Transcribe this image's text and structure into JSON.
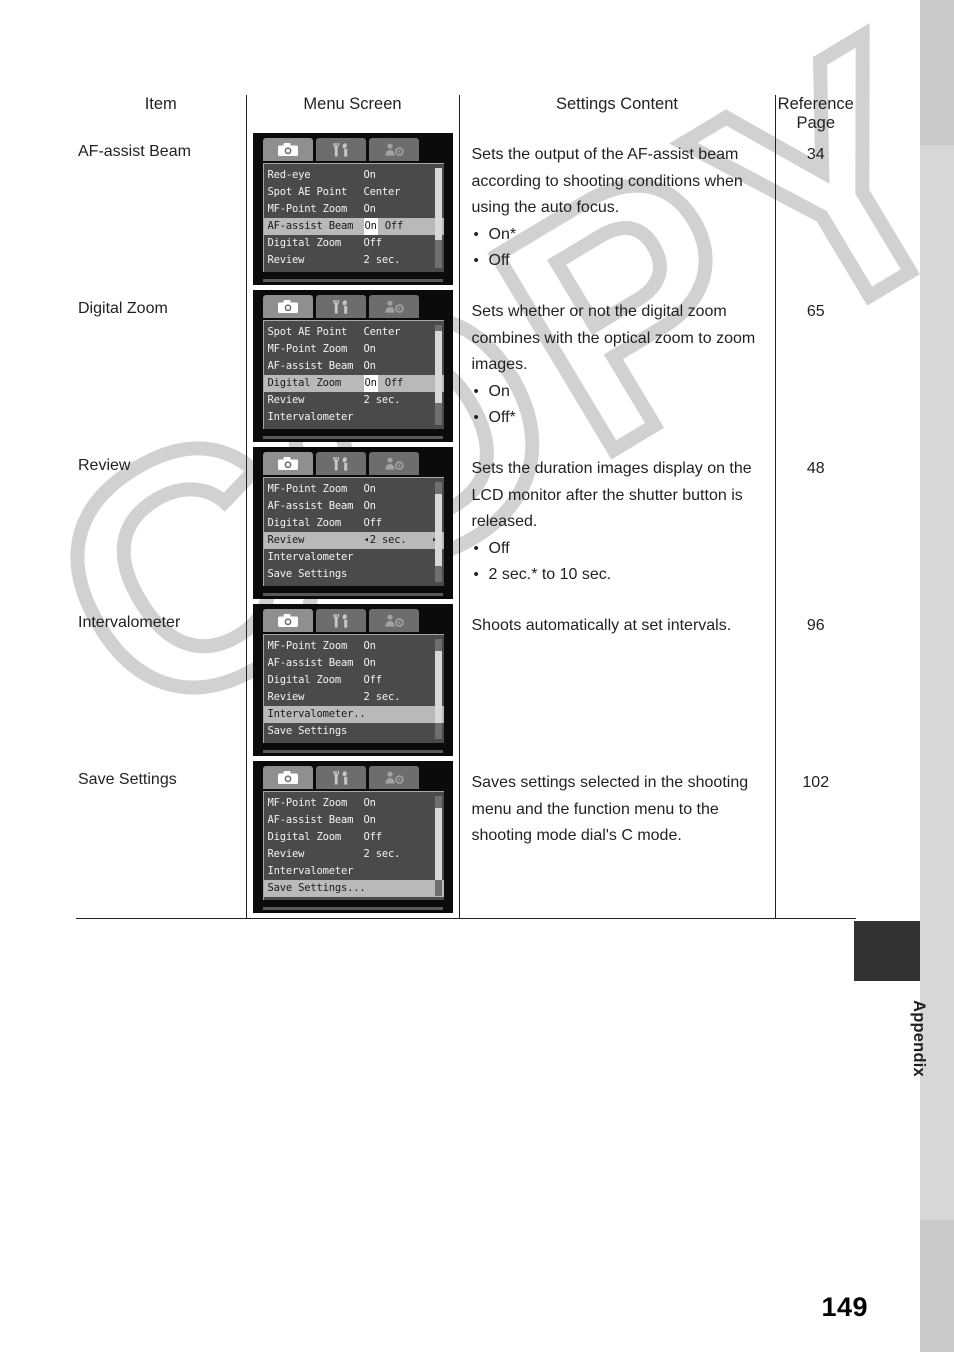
{
  "page": {
    "number": "149",
    "section_tab": "Appendix",
    "watermark": "COPY"
  },
  "table": {
    "headers": {
      "item": "Item",
      "menu_screen": "Menu Screen",
      "settings_content": "Settings Content",
      "reference_page_line1": "Reference",
      "reference_page_line2": "Page"
    },
    "rows": [
      {
        "item": "AF-assist Beam",
        "description_lines": [
          "Sets the output of the AF-assist beam",
          "according to shooting conditions when",
          "using the auto focus."
        ],
        "options": [
          "On*",
          "Off"
        ],
        "reference": "34",
        "menu": {
          "tabs": [
            "camera-icon",
            "tools-icon",
            "setup-icon"
          ],
          "active_tab": 0,
          "entries": [
            {
              "label": "Red-eye",
              "value": "On",
              "value2": "",
              "selected": false,
              "boxed": false,
              "arrows": false
            },
            {
              "label": "Spot AE Point",
              "value": "Center",
              "value2": "",
              "selected": false,
              "boxed": false,
              "arrows": false
            },
            {
              "label": "MF-Point Zoom",
              "value": "On",
              "value2": "",
              "selected": false,
              "boxed": false,
              "arrows": false
            },
            {
              "label": "AF-assist Beam",
              "value": "On",
              "value2": "Off",
              "selected": true,
              "boxed": true,
              "arrows": false
            },
            {
              "label": "Digital Zoom",
              "value": "Off",
              "value2": "",
              "selected": false,
              "boxed": false,
              "arrows": false
            },
            {
              "label": "Review",
              "value": "2 sec.",
              "value2": "",
              "selected": false,
              "boxed": false,
              "arrows": false
            }
          ],
          "scroll_top_pct": 0,
          "scroll_height_pct": 72
        }
      },
      {
        "item": "Digital Zoom",
        "description_lines": [
          "Sets whether or not the digital zoom",
          "combines with the optical zoom to zoom",
          "images."
        ],
        "options": [
          "On",
          "Off*"
        ],
        "reference": "65",
        "menu": {
          "tabs": [
            "camera-icon",
            "tools-icon",
            "setup-icon"
          ],
          "active_tab": 0,
          "entries": [
            {
              "label": "Spot AE Point",
              "value": "Center",
              "value2": "",
              "selected": false,
              "boxed": false,
              "arrows": false
            },
            {
              "label": "MF-Point Zoom",
              "value": "On",
              "value2": "",
              "selected": false,
              "boxed": false,
              "arrows": false
            },
            {
              "label": "AF-assist Beam",
              "value": "On",
              "value2": "",
              "selected": false,
              "boxed": false,
              "arrows": false
            },
            {
              "label": "Digital Zoom",
              "value": "On",
              "value2": "Off",
              "selected": true,
              "boxed": true,
              "arrows": false
            },
            {
              "label": "Review",
              "value": "2 sec.",
              "value2": "",
              "selected": false,
              "boxed": false,
              "arrows": false
            },
            {
              "label": "Intervalometer",
              "value": "",
              "value2": "",
              "selected": false,
              "boxed": false,
              "arrows": false
            }
          ],
          "scroll_top_pct": 6,
          "scroll_height_pct": 72
        }
      },
      {
        "item": "Review",
        "description_lines": [
          "Sets the duration images display on the",
          "LCD monitor after the shutter button is",
          "released."
        ],
        "options": [
          "Off",
          "2 sec.* to 10 sec."
        ],
        "reference": "48",
        "menu": {
          "tabs": [
            "camera-icon",
            "tools-icon",
            "setup-icon"
          ],
          "active_tab": 0,
          "entries": [
            {
              "label": "MF-Point Zoom",
              "value": "On",
              "value2": "",
              "selected": false,
              "boxed": false,
              "arrows": false
            },
            {
              "label": "AF-assist Beam",
              "value": "On",
              "value2": "",
              "selected": false,
              "boxed": false,
              "arrows": false
            },
            {
              "label": "Digital Zoom",
              "value": "Off",
              "value2": "",
              "selected": false,
              "boxed": false,
              "arrows": false
            },
            {
              "label": "Review",
              "value": "2 sec.",
              "value2": "",
              "selected": true,
              "boxed": false,
              "arrows": true
            },
            {
              "label": "Intervalometer",
              "value": "",
              "value2": "",
              "selected": false,
              "boxed": false,
              "arrows": false
            },
            {
              "label": "Save Settings",
              "value": "",
              "value2": "",
              "selected": false,
              "boxed": false,
              "arrows": false
            }
          ],
          "scroll_top_pct": 12,
          "scroll_height_pct": 72
        }
      },
      {
        "item": "Intervalometer",
        "description_lines": [
          "Shoots automatically at set intervals."
        ],
        "options": [],
        "reference": "96",
        "menu": {
          "tabs": [
            "camera-icon",
            "tools-icon",
            "setup-icon"
          ],
          "active_tab": 0,
          "entries": [
            {
              "label": "MF-Point Zoom",
              "value": "On",
              "value2": "",
              "selected": false,
              "boxed": false,
              "arrows": false
            },
            {
              "label": "AF-assist Beam",
              "value": "On",
              "value2": "",
              "selected": false,
              "boxed": false,
              "arrows": false
            },
            {
              "label": "Digital Zoom",
              "value": "Off",
              "value2": "",
              "selected": false,
              "boxed": false,
              "arrows": false
            },
            {
              "label": "Review",
              "value": "2 sec.",
              "value2": "",
              "selected": false,
              "boxed": false,
              "arrows": false
            },
            {
              "label": "Intervalometer...",
              "value": "",
              "value2": "",
              "selected": true,
              "boxed": false,
              "arrows": false
            },
            {
              "label": "Save Settings",
              "value": "",
              "value2": "",
              "selected": false,
              "boxed": false,
              "arrows": false
            }
          ],
          "scroll_top_pct": 12,
          "scroll_height_pct": 72
        }
      },
      {
        "item": "Save Settings",
        "description_lines": [
          "Saves settings selected in the shooting",
          "menu and the function menu to the",
          "shooting mode dial's C mode."
        ],
        "options": [],
        "reference": "102",
        "menu": {
          "tabs": [
            "camera-icon",
            "tools-icon",
            "setup-icon"
          ],
          "active_tab": 0,
          "entries": [
            {
              "label": "MF-Point Zoom",
              "value": "On",
              "value2": "",
              "selected": false,
              "boxed": false,
              "arrows": false
            },
            {
              "label": "AF-assist Beam",
              "value": "On",
              "value2": "",
              "selected": false,
              "boxed": false,
              "arrows": false
            },
            {
              "label": "Digital Zoom",
              "value": "Off",
              "value2": "",
              "selected": false,
              "boxed": false,
              "arrows": false
            },
            {
              "label": "Review",
              "value": "2 sec.",
              "value2": "",
              "selected": false,
              "boxed": false,
              "arrows": false
            },
            {
              "label": "Intervalometer",
              "value": "",
              "value2": "",
              "selected": false,
              "boxed": false,
              "arrows": false
            },
            {
              "label": "Save Settings...",
              "value": "",
              "value2": "",
              "selected": true,
              "boxed": false,
              "arrows": false
            }
          ],
          "scroll_top_pct": 12,
          "scroll_height_pct": 72
        }
      }
    ]
  },
  "colors": {
    "ink": "#231f20",
    "watermark": "#cfcfcf",
    "tab_dark": "#333333",
    "edge_band_light": "#d7d7d7",
    "edge_band_dark": "#c9c9c9"
  }
}
